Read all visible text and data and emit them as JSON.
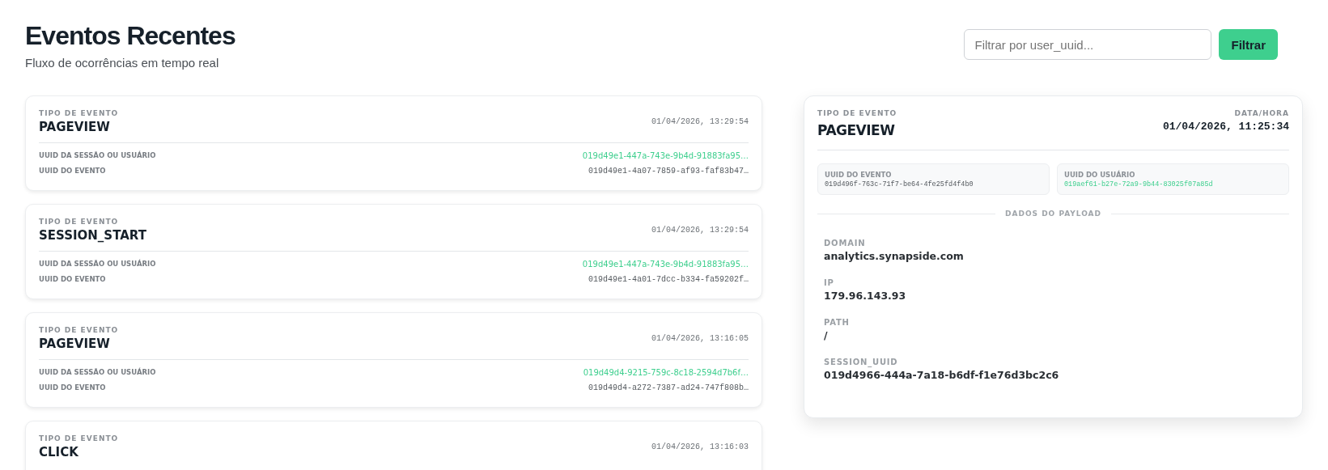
{
  "header": {
    "title": "Eventos Recentes",
    "subtitle": "Fluxo de ocorrências em tempo real"
  },
  "filter": {
    "placeholder": "Filtrar por user_uuid...",
    "button": "Filtrar"
  },
  "events": [
    {
      "type_label": "TIPO DE EVENTO",
      "type": "PAGEVIEW",
      "timestamp": "01/04/2026, 13:29:54",
      "fields": [
        {
          "label": "UUID DA SESSÃO OU USUÁRIO",
          "value": "019d49e1-447a-743e-9b4d-91883fa95…",
          "kind": "user"
        },
        {
          "label": "UUID DO EVENTO",
          "value": "019d49e1-4a07-7859-af93-faf83b47…",
          "kind": "event"
        }
      ]
    },
    {
      "type_label": "TIPO DE EVENTO",
      "type": "SESSION_START",
      "timestamp": "01/04/2026, 13:29:54",
      "fields": [
        {
          "label": "UUID DA SESSÃO OU USUÁRIO",
          "value": "019d49e1-447a-743e-9b4d-91883fa95…",
          "kind": "user"
        },
        {
          "label": "UUID DO EVENTO",
          "value": "019d49e1-4a01-7dcc-b334-fa59202f…",
          "kind": "event"
        }
      ]
    },
    {
      "type_label": "TIPO DE EVENTO",
      "type": "PAGEVIEW",
      "timestamp": "01/04/2026, 13:16:05",
      "fields": [
        {
          "label": "UUID DA SESSÃO OU USUÁRIO",
          "value": "019d49d4-9215-759c-8c18-2594d7b6f…",
          "kind": "user"
        },
        {
          "label": "UUID DO EVENTO",
          "value": "019d49d4-a272-7387-ad24-747f808b…",
          "kind": "event"
        }
      ]
    },
    {
      "type_label": "TIPO DE EVENTO",
      "type": "CLICK",
      "timestamp": "01/04/2026, 13:16:03"
    }
  ],
  "detail": {
    "type_label": "TIPO DE EVENTO",
    "type": "PAGEVIEW",
    "date_label": "DATA/HORA",
    "timestamp": "01/04/2026, 11:25:34",
    "ids": [
      {
        "label": "UUID DO EVENTO",
        "value": "019d496f-763c-71f7-be64-4fe25fd4f4b0",
        "kind": "event"
      },
      {
        "label": "UUID DO USUÁRIO",
        "value": "019aef61-b27e-72a9-9b44-83025f07a85d",
        "kind": "user"
      }
    ],
    "payload_title": "DADOS DO PAYLOAD",
    "payload": [
      {
        "key": "DOMAIN",
        "value": "analytics.synapside.com"
      },
      {
        "key": "IP",
        "value": "179.96.143.93"
      },
      {
        "key": "PATH",
        "value": "/"
      },
      {
        "key": "SESSION_UUID",
        "value": "019d4966-444a-7a18-b6df-f1e76d3bc2c6"
      }
    ]
  }
}
